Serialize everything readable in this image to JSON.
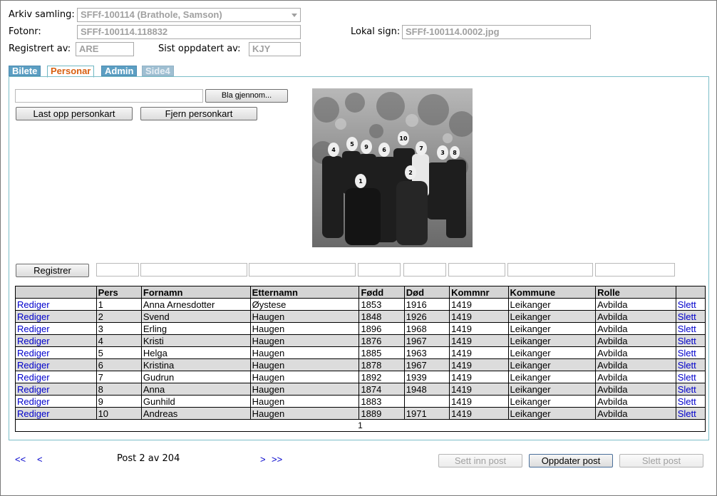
{
  "header": {
    "arkiv_label": "Arkiv samling:",
    "arkiv_value": "SFFf-100114 (Brathole, Samson)",
    "fotonr_label": "Fotonr:",
    "fotonr_value": "SFFf-100114.118832",
    "lokal_label": "Lokal sign:",
    "lokal_value": "SFFf-100114.0002.jpg",
    "reg_label": "Registrert av:",
    "reg_value": "ARE",
    "oppdatert_label": "Sist oppdatert av:",
    "oppdatert_value": "KJY"
  },
  "tabs": [
    "Bilete",
    "Personar",
    "Admin",
    "Side4"
  ],
  "active_tab": "Personar",
  "buttons": {
    "browse": "Bla gjennom...",
    "upload": "Last opp personkart",
    "remove": "Fjern personkart",
    "register": "Registrer",
    "insert": "Sett inn post",
    "update": "Oppdater post",
    "delete": "Slett post"
  },
  "photo": {
    "numbers": [
      "4",
      "5",
      "9",
      "6",
      "10",
      "7",
      "3",
      "8",
      "1",
      "2"
    ]
  },
  "table": {
    "columns": [
      "",
      "Pers",
      "Fornamn",
      "Etternamn",
      "Fødd",
      "Død",
      "Kommnr",
      "Kommune",
      "Rolle",
      ""
    ],
    "edit_label": "Rediger",
    "delete_label": "Slett",
    "rows": [
      {
        "pers": "1",
        "fornamn": "Anna Arnesdotter",
        "etternamn": "Øystese",
        "fodd": "1853",
        "dod": "1916",
        "kommnr": "1419",
        "kommune": "Leikanger",
        "rolle": "Avbilda"
      },
      {
        "pers": "2",
        "fornamn": "Svend",
        "etternamn": "Haugen",
        "fodd": "1848",
        "dod": "1926",
        "kommnr": "1419",
        "kommune": "Leikanger",
        "rolle": "Avbilda"
      },
      {
        "pers": "3",
        "fornamn": "Erling",
        "etternamn": "Haugen",
        "fodd": "1896",
        "dod": "1968",
        "kommnr": "1419",
        "kommune": "Leikanger",
        "rolle": "Avbilda"
      },
      {
        "pers": "4",
        "fornamn": "Kristi",
        "etternamn": "Haugen",
        "fodd": "1876",
        "dod": "1967",
        "kommnr": "1419",
        "kommune": "Leikanger",
        "rolle": "Avbilda"
      },
      {
        "pers": "5",
        "fornamn": "Helga",
        "etternamn": "Haugen",
        "fodd": "1885",
        "dod": "1963",
        "kommnr": "1419",
        "kommune": "Leikanger",
        "rolle": "Avbilda"
      },
      {
        "pers": "6",
        "fornamn": "Kristina",
        "etternamn": "Haugen",
        "fodd": "1878",
        "dod": "1967",
        "kommnr": "1419",
        "kommune": "Leikanger",
        "rolle": "Avbilda"
      },
      {
        "pers": "7",
        "fornamn": "Gudrun",
        "etternamn": "Haugen",
        "fodd": "1892",
        "dod": "1939",
        "kommnr": "1419",
        "kommune": "Leikanger",
        "rolle": "Avbilda"
      },
      {
        "pers": "8",
        "fornamn": "Anna",
        "etternamn": "Haugen",
        "fodd": "1874",
        "dod": "1948",
        "kommnr": "1419",
        "kommune": "Leikanger",
        "rolle": "Avbilda"
      },
      {
        "pers": "9",
        "fornamn": "Gunhild",
        "etternamn": "Haugen",
        "fodd": "1883",
        "dod": "",
        "kommnr": "1419",
        "kommune": "Leikanger",
        "rolle": "Avbilda"
      },
      {
        "pers": "10",
        "fornamn": "Andreas",
        "etternamn": "Haugen",
        "fodd": "1889",
        "dod": "1971",
        "kommnr": "1419",
        "kommune": "Leikanger",
        "rolle": "Avbilda"
      }
    ],
    "page": "1"
  },
  "nav": {
    "first": "<<",
    "prev": "<",
    "next": ">",
    "last": ">>",
    "post_text": "Post 2 av 204"
  }
}
